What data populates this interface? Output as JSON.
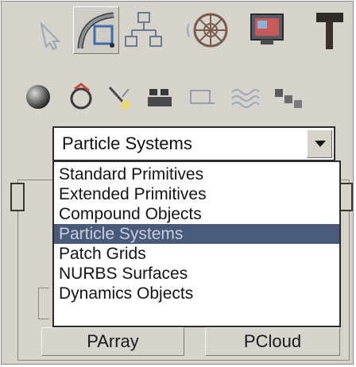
{
  "toolbar": {
    "tabs": [
      {
        "icon": "select-arrow-icon"
      },
      {
        "icon": "create-curve-icon",
        "active": true
      },
      {
        "icon": "hierarchy-icon"
      },
      {
        "icon": "motion-wheel-icon"
      },
      {
        "icon": "display-monitor-icon"
      },
      {
        "icon": "utilities-hammer-icon"
      }
    ]
  },
  "create_categories": [
    {
      "icon": "geometry-sphere-icon",
      "active": true
    },
    {
      "icon": "shapes-icon"
    },
    {
      "icon": "lights-icon"
    },
    {
      "icon": "cameras-icon"
    },
    {
      "icon": "helpers-icon"
    },
    {
      "icon": "space-warps-icon"
    },
    {
      "icon": "systems-icon"
    }
  ],
  "dropdown": {
    "selected": "Particle Systems",
    "options": [
      "Standard Primitives",
      "Extended Primitives",
      "Compound Objects",
      "Particle Systems",
      "Patch Grids",
      "NURBS Surfaces",
      "Dynamics Objects"
    ],
    "highlighted_index": 3
  },
  "object_buttons": [
    "PArray",
    "PCloud"
  ],
  "colors": {
    "panel_bg": "#d6d2cc",
    "highlight": "#4a5a7a"
  }
}
